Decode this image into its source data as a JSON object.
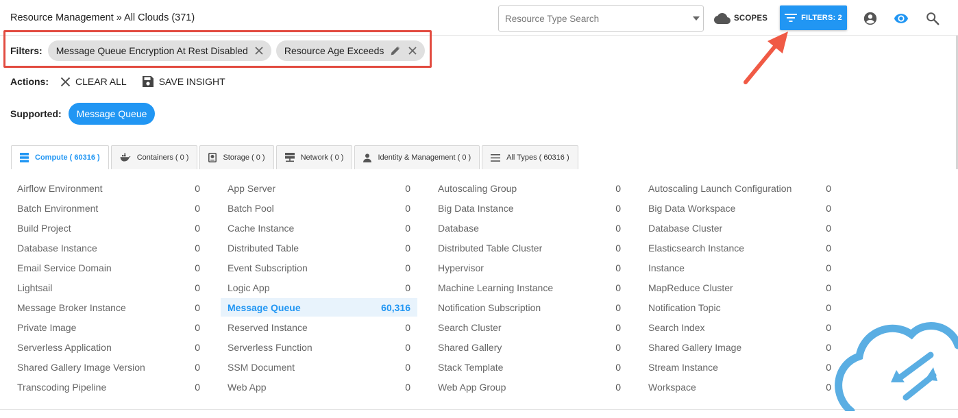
{
  "header": {
    "breadcrumb": "Resource Management » All Clouds (371)",
    "type_search_placeholder": "Resource Type Search",
    "scopes_label": "SCOPES",
    "filters_button_label": "FILTERS: 2"
  },
  "filters": {
    "label": "Filters:",
    "chips": [
      {
        "label": "Message Queue Encryption At Rest Disabled"
      },
      {
        "label": "Resource Age Exceeds"
      }
    ]
  },
  "actions": {
    "label": "Actions:",
    "clear_all": "CLEAR ALL",
    "save_insight": "SAVE INSIGHT"
  },
  "supported": {
    "label": "Supported:",
    "pill": "Message Queue"
  },
  "tabs": [
    {
      "name": "Compute",
      "count": "( 60316 )",
      "active": true
    },
    {
      "name": "Containers",
      "count": "( 0 )"
    },
    {
      "name": "Storage",
      "count": "( 0 )"
    },
    {
      "name": "Network",
      "count": "( 0 )"
    },
    {
      "name": "Identity & Management",
      "count": "( 0 )"
    },
    {
      "name": "All Types",
      "count": "( 60316 )"
    }
  ],
  "resource_columns": [
    [
      {
        "name": "Airflow Environment",
        "count": "0"
      },
      {
        "name": "Batch Environment",
        "count": "0"
      },
      {
        "name": "Build Project",
        "count": "0"
      },
      {
        "name": "Database Instance",
        "count": "0"
      },
      {
        "name": "Email Service Domain",
        "count": "0"
      },
      {
        "name": "Lightsail",
        "count": "0"
      },
      {
        "name": "Message Broker Instance",
        "count": "0"
      },
      {
        "name": "Private Image",
        "count": "0"
      },
      {
        "name": "Serverless Application",
        "count": "0"
      },
      {
        "name": "Shared Gallery Image Version",
        "count": "0"
      },
      {
        "name": "Transcoding Pipeline",
        "count": "0"
      }
    ],
    [
      {
        "name": "App Server",
        "count": "0"
      },
      {
        "name": "Batch Pool",
        "count": "0"
      },
      {
        "name": "Cache Instance",
        "count": "0"
      },
      {
        "name": "Distributed Table",
        "count": "0"
      },
      {
        "name": "Event Subscription",
        "count": "0"
      },
      {
        "name": "Logic App",
        "count": "0"
      },
      {
        "name": "Message Queue",
        "count": "60,316",
        "selected": true
      },
      {
        "name": "Reserved Instance",
        "count": "0"
      },
      {
        "name": "Serverless Function",
        "count": "0"
      },
      {
        "name": "SSM Document",
        "count": "0"
      },
      {
        "name": "Web App",
        "count": "0"
      }
    ],
    [
      {
        "name": "Autoscaling Group",
        "count": "0"
      },
      {
        "name": "Big Data Instance",
        "count": "0"
      },
      {
        "name": "Database",
        "count": "0"
      },
      {
        "name": "Distributed Table Cluster",
        "count": "0"
      },
      {
        "name": "Hypervisor",
        "count": "0"
      },
      {
        "name": "Machine Learning Instance",
        "count": "0"
      },
      {
        "name": "Notification Subscription",
        "count": "0"
      },
      {
        "name": "Search Cluster",
        "count": "0"
      },
      {
        "name": "Shared Gallery",
        "count": "0"
      },
      {
        "name": "Stack Template",
        "count": "0"
      },
      {
        "name": "Web App Group",
        "count": "0"
      }
    ],
    [
      {
        "name": "Autoscaling Launch Configuration",
        "count": "0"
      },
      {
        "name": "Big Data Workspace",
        "count": "0"
      },
      {
        "name": "Database Cluster",
        "count": "0"
      },
      {
        "name": "Elasticsearch Instance",
        "count": "0"
      },
      {
        "name": "Instance",
        "count": "0"
      },
      {
        "name": "MapReduce Cluster",
        "count": "0"
      },
      {
        "name": "Notification Topic",
        "count": "0"
      },
      {
        "name": "Search Index",
        "count": "0"
      },
      {
        "name": "Shared Gallery Image",
        "count": "0"
      },
      {
        "name": "Stream Instance",
        "count": "0"
      },
      {
        "name": "Workspace",
        "count": "0"
      }
    ]
  ],
  "colors": {
    "accent": "#2196f3",
    "highlight_box": "#e24b40",
    "arrow": "#f05a45",
    "selected_row_bg": "#e8f3fc"
  },
  "icons": {
    "scopes": "cloud-icon",
    "filters": "filter-icon",
    "account": "account-circle-icon",
    "view": "eye-icon",
    "search": "search-icon",
    "chip_remove": "close-icon",
    "chip_edit": "pencil-icon",
    "clear_all": "close-icon",
    "save_insight": "floppy-disk-icon",
    "tab_compute": "server-stack-icon",
    "tab_containers": "docker-whale-icon",
    "tab_storage": "hard-drive-icon",
    "tab_network": "network-server-icon",
    "tab_identity": "person-icon",
    "tab_all_types": "list-icon",
    "brand": "cloud-sync-logo"
  }
}
